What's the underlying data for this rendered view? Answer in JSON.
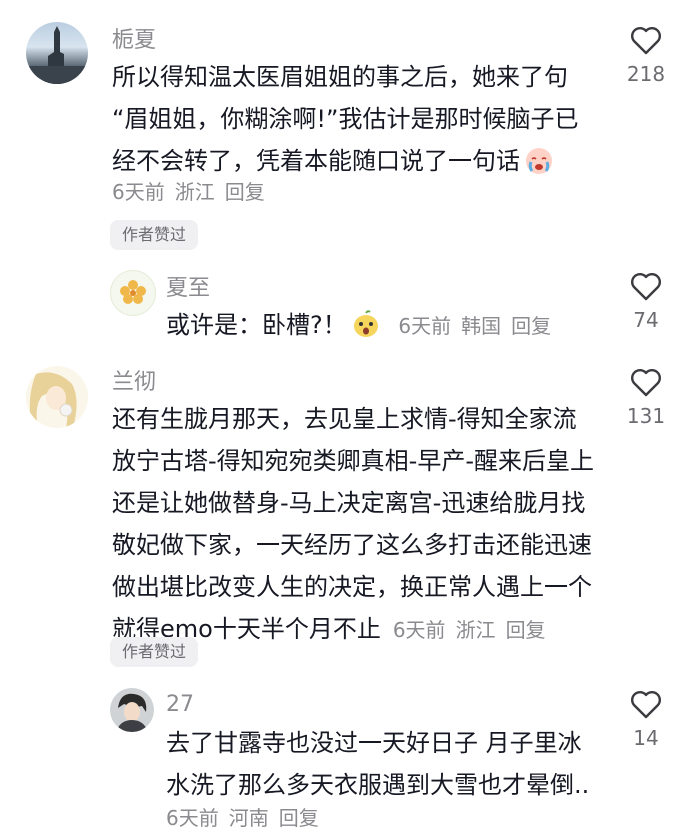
{
  "comments": [
    {
      "username": "栀夏",
      "lines": [
        "所以得知温太医眉姐姐的事之后，她来了句",
        "“眉姐姐，你糊涂啊!”我估计是那时候脑子已",
        "经不会转了，凭着本能随口说了一句话"
      ],
      "time": "6天前",
      "location": "浙江",
      "reply": "回复",
      "likes": "218",
      "author_liked": "作者赞过",
      "reply_child": {
        "username": "夏至",
        "text": "或许是：卧槽?！",
        "time": "6天前",
        "location": "韩国",
        "reply": "回复",
        "likes": "74"
      }
    },
    {
      "username": "兰彻",
      "lines": [
        "还有生胧月那天，去见皇上求情-得知全家流",
        "放宁古塔-得知宛宛类卿真相-早产-醒来后皇上",
        "还是让她做替身-马上决定离宫-迅速给胧月找",
        "敬妃做下家，一天经历了这么多打击还能迅速",
        "做出堪比改变人生的决定，换正常人遇上一个",
        "就得emo十天半个月不止"
      ],
      "time": "6天前",
      "location": "浙江",
      "reply": "回复",
      "likes": "131",
      "author_liked": "作者赞过",
      "reply_child": {
        "username": "27",
        "lines": [
          "去了甘露寺也没过一天好日子 月子里冰",
          "水洗了那么多天衣服遇到大雪也才晕倒.."
        ],
        "time": "6天前",
        "location": "河南",
        "reply": "回复",
        "likes": "14"
      }
    }
  ],
  "icons": {
    "like": "heart-outline-icon",
    "emoji_cry": "crying-face-emoji",
    "emoji_shock": "shocked-face-emoji"
  },
  "colors": {
    "text": "#161823",
    "secondary": "#8a8a8f",
    "pill_bg": "#f0f0f2"
  }
}
